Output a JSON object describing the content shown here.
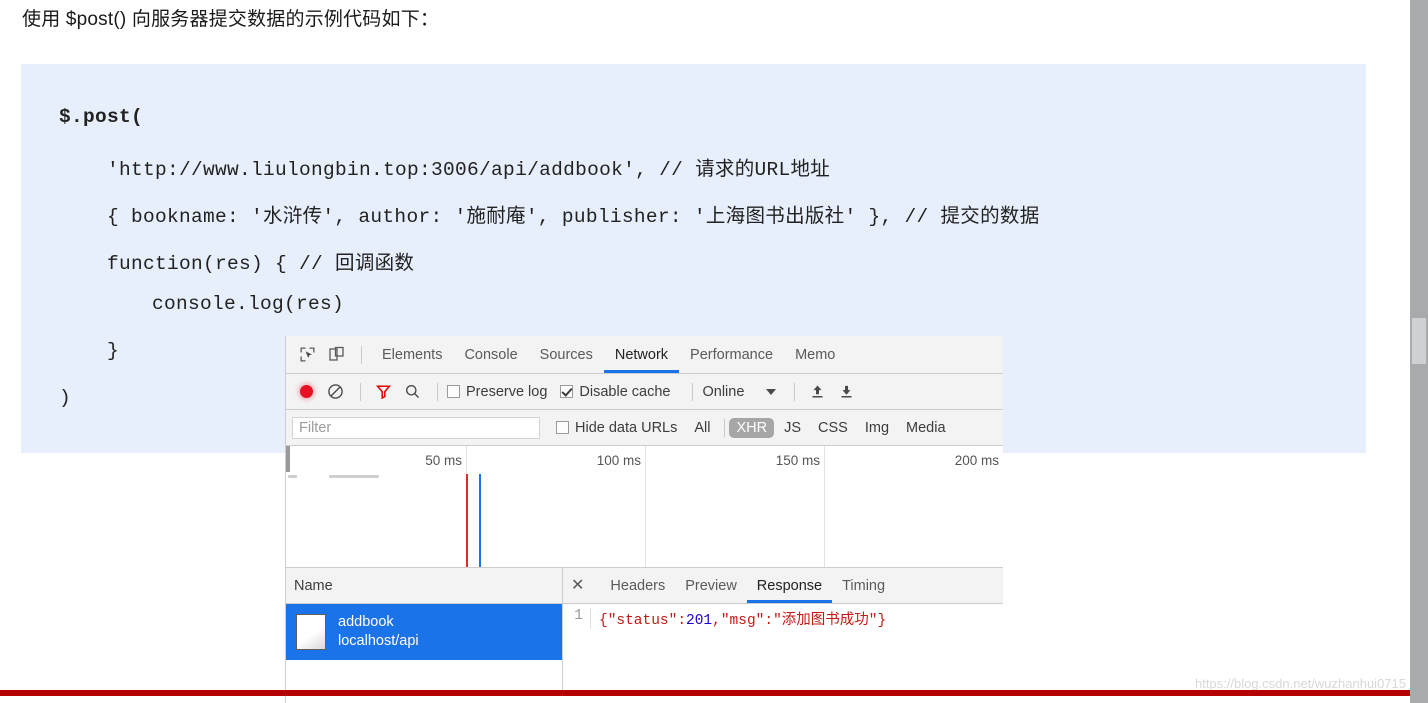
{
  "intro": {
    "text": "使用 $post() 向服务器提交数据的示例代码如下："
  },
  "code": {
    "lines": [
      "$.post(",
      "'http://www.liulongbin.top:3006/api/addbook', // 请求的URL地址",
      "{ bookname: '水浒传', author: '施耐庵', publisher: '上海图书出版社' }, // 提交的数据",
      "function(res) { // 回调函数",
      "console.log(res)",
      "}",
      ")"
    ]
  },
  "devtools": {
    "icons": {
      "inspect": "inspect-element-icon",
      "device": "device-toolbar-icon",
      "record": "record-icon",
      "clear": "clear-icon",
      "filter": "filter-icon",
      "search": "search-icon",
      "import": "import-har-icon",
      "export": "export-har-icon"
    },
    "tabs": [
      {
        "label": "Elements",
        "active": false
      },
      {
        "label": "Console",
        "active": false
      },
      {
        "label": "Sources",
        "active": false
      },
      {
        "label": "Network",
        "active": true
      },
      {
        "label": "Performance",
        "active": false
      },
      {
        "label": "Memo",
        "active": false
      }
    ],
    "toolbar": {
      "preserve_log": {
        "label": "Preserve log",
        "checked": false
      },
      "disable_cache": {
        "label": "Disable cache",
        "checked": true
      },
      "throttle": "Online"
    },
    "filterbar": {
      "filter_placeholder": "Filter",
      "filter_value": "",
      "hide_data_urls": {
        "label": "Hide data URLs",
        "checked": false
      },
      "types": [
        {
          "label": "All",
          "selected": false
        },
        {
          "label": "XHR",
          "selected": true
        },
        {
          "label": "JS",
          "selected": false
        },
        {
          "label": "CSS",
          "selected": false
        },
        {
          "label": "Img",
          "selected": false
        },
        {
          "label": "Media",
          "selected": false
        }
      ]
    },
    "overview": {
      "ticks": [
        "50 ms",
        "100 ms",
        "150 ms",
        "200 ms"
      ],
      "marker_red_ms": 54,
      "marker_blue_ms": 58
    },
    "requests": {
      "column_header": "Name",
      "rows": [
        {
          "name": "addbook",
          "path": "localhost/api",
          "selected": true
        }
      ]
    },
    "detail": {
      "close_label": "✕",
      "tabs": [
        {
          "label": "Headers",
          "active": false
        },
        {
          "label": "Preview",
          "active": false
        },
        {
          "label": "Response",
          "active": true
        },
        {
          "label": "Timing",
          "active": false
        }
      ],
      "response": {
        "line_number": "1",
        "tokens": [
          {
            "text": "{",
            "type": "punc"
          },
          {
            "text": "\"status\"",
            "type": "str"
          },
          {
            "text": ":",
            "type": "punc"
          },
          {
            "text": "201",
            "type": "num"
          },
          {
            "text": ",",
            "type": "punc"
          },
          {
            "text": "\"msg\"",
            "type": "str"
          },
          {
            "text": ":",
            "type": "punc"
          },
          {
            "text": "\"添加图书成功\"",
            "type": "str"
          },
          {
            "text": "}",
            "type": "punc"
          }
        ]
      }
    }
  },
  "watermark": {
    "text": "https://blog.csdn.net/wuzhanhui0715"
  },
  "colors": {
    "code_bg": "#e8effc",
    "accent_blue": "#1a73e8",
    "record_red": "#e81123",
    "bottom_bar_red": "#b40000",
    "string_red": "#c41a16",
    "number_blue": "#1c00cf"
  }
}
